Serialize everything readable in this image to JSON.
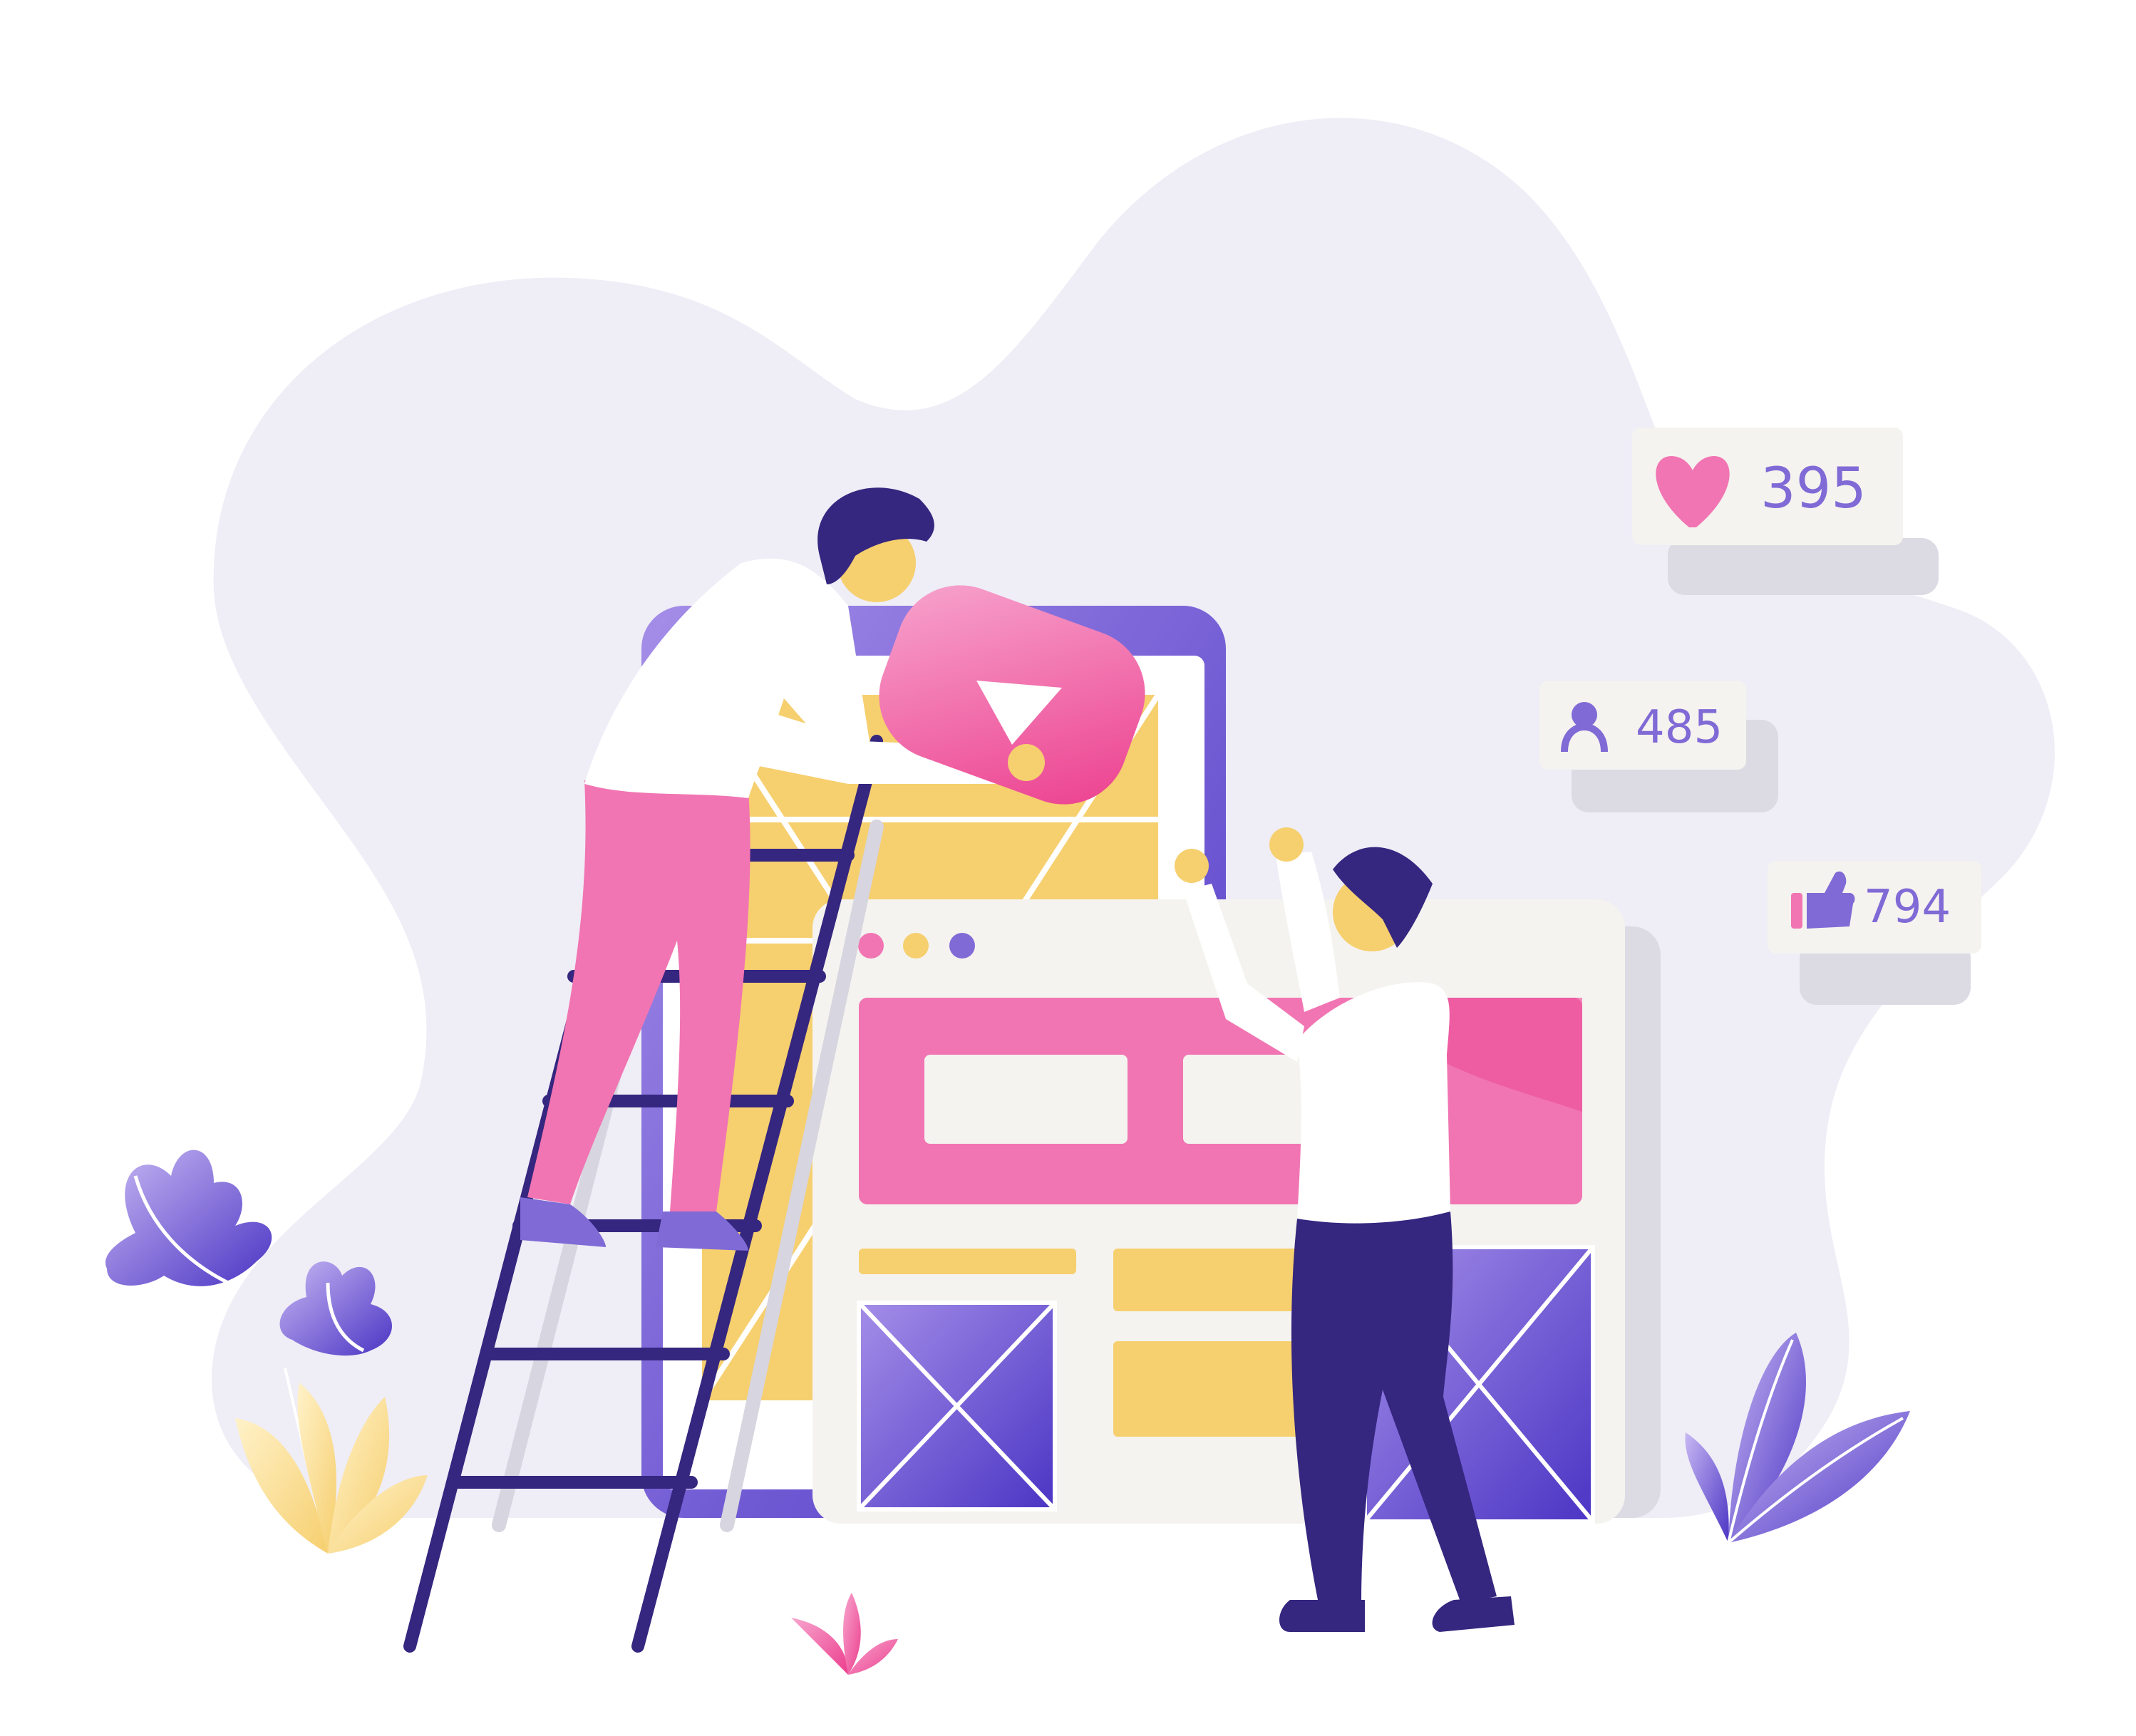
{
  "stats": {
    "likes": {
      "value": "395",
      "icon": "heart-icon"
    },
    "followers": {
      "value": "485",
      "icon": "user-icon"
    },
    "thumbs": {
      "value": "794",
      "icon": "thumbs-up-icon"
    }
  },
  "colors": {
    "blob": "#efedf6",
    "purple": "#7f6ad6",
    "deep_purple": "#35267f",
    "pink": "#f175b2",
    "yellow": "#f6cf6f",
    "card": "#f4f3ef"
  }
}
